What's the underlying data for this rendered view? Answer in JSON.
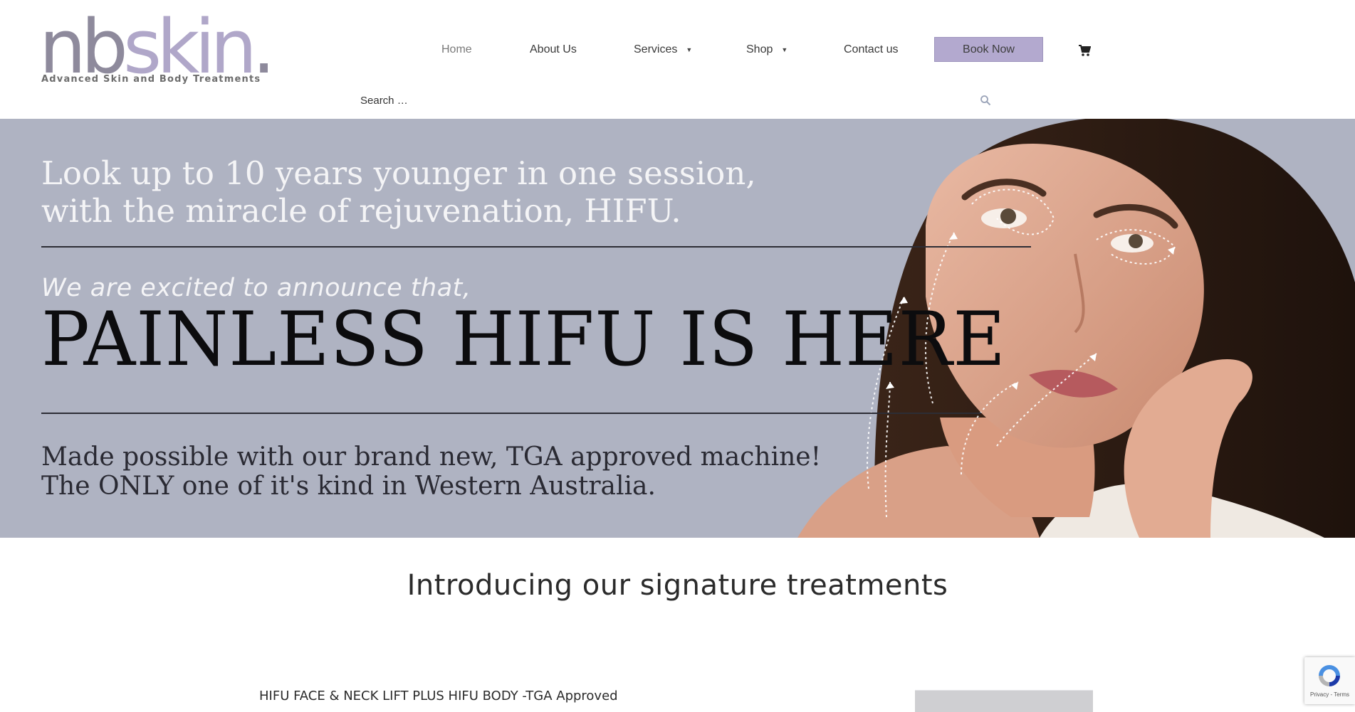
{
  "header": {
    "logo": {
      "wordmark_left": "nb",
      "wordmark_accent": "skin",
      "wordmark_dot": ".",
      "tagline": "Advanced Skin and Body Treatments"
    },
    "nav": [
      {
        "label": "Home",
        "active": true,
        "has_dropdown": false
      },
      {
        "label": "About Us",
        "active": false,
        "has_dropdown": false
      },
      {
        "label": "Services",
        "active": false,
        "has_dropdown": true
      },
      {
        "label": "Shop",
        "active": false,
        "has_dropdown": true
      },
      {
        "label": "Contact us",
        "active": false,
        "has_dropdown": false
      }
    ],
    "book_button": "Book Now",
    "cart_icon": "cart-icon",
    "search": {
      "placeholder": "Search …",
      "value": "",
      "icon": "search-icon"
    }
  },
  "hero": {
    "line1": "Look up to 10 years younger in one session,",
    "line2": "with the miracle of rejuvenation, HIFU.",
    "intro": "We are excited to announce that,",
    "headline": "PAINLESS HIFU IS HERE",
    "sub1": "Made possible with our brand new, TGA approved machine!",
    "sub2": "The ONLY one of it's kind in Western Australia.",
    "background_color": "#afb3c2"
  },
  "intro": {
    "title": "Introducing our signature treatments",
    "first_treatment": "HIFU FACE & NECK LIFT PLUS HIFU BODY -TGA Approved"
  },
  "recaptcha": {
    "label": "Privacy - Terms"
  },
  "colors": {
    "accent": "#b3a9cf",
    "logo_gray": "#8e8a9c",
    "logo_lilac": "#b0a7c9"
  }
}
